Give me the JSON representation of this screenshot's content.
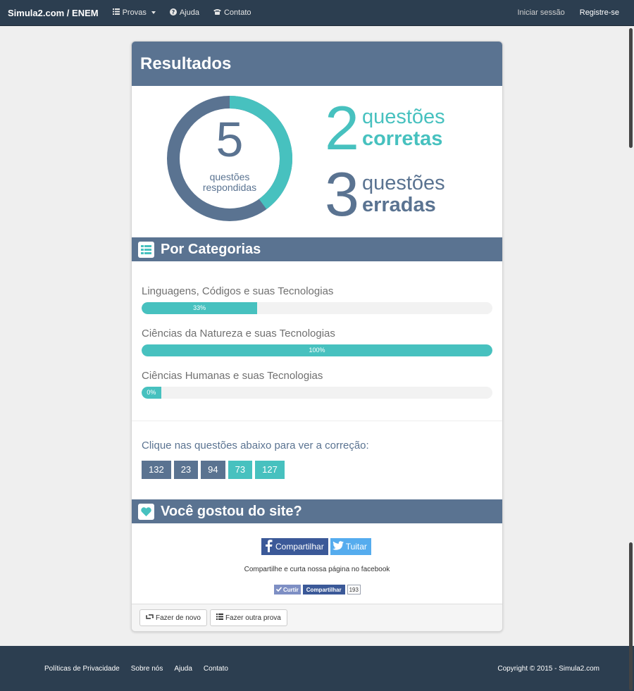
{
  "navbar": {
    "brand": "Simula2.com / ENEM",
    "items": [
      {
        "label": "Provas",
        "icon": "list-icon"
      },
      {
        "label": "Ajuda",
        "icon": "help-icon"
      },
      {
        "label": "Contato",
        "icon": "phone-icon"
      }
    ],
    "login": "Iniciar sessão",
    "register": "Registre-se"
  },
  "results": {
    "title": "Resultados",
    "answered_count": "5",
    "answered_label_1": "questões",
    "answered_label_2": "respondidas",
    "correct_count": "2",
    "correct_word_1": "questões",
    "correct_word_2": "corretas",
    "wrong_count": "3",
    "wrong_word_1": "questões",
    "wrong_word_2": "erradas",
    "correct_fraction": 0.4,
    "colors": {
      "correct": "#47c1bf",
      "wrong": "#5a7391"
    }
  },
  "categories": {
    "title": "Por Categorias",
    "items": [
      {
        "label": "Linguagens, Códigos e suas Tecnologias",
        "percent": "33%",
        "value": 33
      },
      {
        "label": "Ciências da Natureza e suas Tecnologias",
        "percent": "100%",
        "value": 100
      },
      {
        "label": "Ciências Humanas e suas Tecnologias",
        "percent": "0%",
        "value": 0
      }
    ]
  },
  "questions": {
    "title": "Clique nas questões abaixo para ver a correção:",
    "items": [
      {
        "number": "132",
        "status": "wrong"
      },
      {
        "number": "23",
        "status": "wrong"
      },
      {
        "number": "94",
        "status": "wrong"
      },
      {
        "number": "73",
        "status": "right"
      },
      {
        "number": "127",
        "status": "right"
      }
    ]
  },
  "share": {
    "title": "Você gostou do site?",
    "facebook_label": "Compartilhar",
    "twitter_label": "Tuitar",
    "text": "Compartilhe e curta nossa página no facebook",
    "like_label": "Curtir",
    "share_label": "Compartilhar",
    "count": "193"
  },
  "actions": {
    "retry": "Fazer de novo",
    "other": "Fazer outra prova"
  },
  "footer": {
    "links": [
      "Políticas de Privacidade",
      "Sobre nós",
      "Ajuda",
      "Contato"
    ],
    "copyright": "Copyright © 2015 - Simula2.com"
  }
}
